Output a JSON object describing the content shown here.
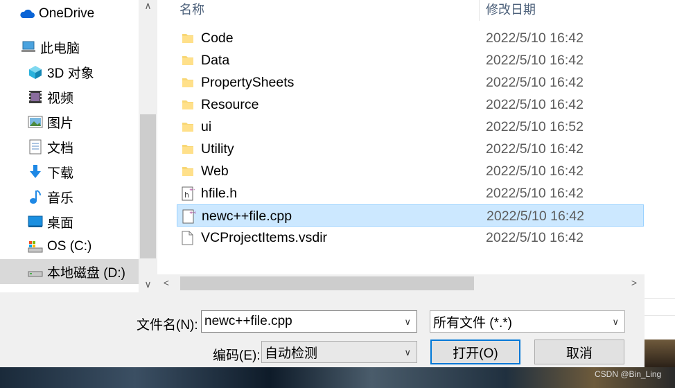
{
  "nav": {
    "items": [
      {
        "label": "OneDrive",
        "icon": "onedrive-cloud-icon"
      },
      {
        "label": "此电脑",
        "icon": "this-pc-icon"
      },
      {
        "label": "3D 对象",
        "icon": "3d-objects-icon"
      },
      {
        "label": "视频",
        "icon": "video-icon"
      },
      {
        "label": "图片",
        "icon": "pictures-icon"
      },
      {
        "label": "文档",
        "icon": "documents-icon"
      },
      {
        "label": "下载",
        "icon": "download-arrow-icon"
      },
      {
        "label": "音乐",
        "icon": "music-note-icon"
      },
      {
        "label": "桌面",
        "icon": "desktop-icon"
      },
      {
        "label": "OS (C:)",
        "icon": "drive-c-icon"
      },
      {
        "label": "本地磁盘 (D:)",
        "icon": "drive-d-icon"
      }
    ],
    "selected_index": 10
  },
  "columns": {
    "name": "名称",
    "date": "修改日期"
  },
  "files": [
    {
      "name": "Code",
      "date": "2022/5/10 16:42",
      "type": "folder"
    },
    {
      "name": "Data",
      "date": "2022/5/10 16:42",
      "type": "folder"
    },
    {
      "name": "PropertySheets",
      "date": "2022/5/10 16:42",
      "type": "folder"
    },
    {
      "name": "Resource",
      "date": "2022/5/10 16:42",
      "type": "folder"
    },
    {
      "name": "ui",
      "date": "2022/5/10 16:52",
      "type": "folder"
    },
    {
      "name": "Utility",
      "date": "2022/5/10 16:42",
      "type": "folder"
    },
    {
      "name": "Web",
      "date": "2022/5/10 16:42",
      "type": "folder"
    },
    {
      "name": "hfile.h",
      "date": "2022/5/10 16:42",
      "type": "header"
    },
    {
      "name": "newc++file.cpp",
      "date": "2022/5/10 16:42",
      "type": "cpp"
    },
    {
      "name": "VCProjectItems.vsdir",
      "date": "2022/5/10 16:42",
      "type": "file"
    }
  ],
  "selected_file_index": 8,
  "bottom": {
    "filename_label": "文件名(N):",
    "filename_value": "newc++file.cpp",
    "filter_value": "所有文件 (*.*)",
    "encoding_label": "编码(E):",
    "encoding_value": "自动检测",
    "open_button": "打开(O)",
    "cancel_button": "取消"
  },
  "watermark": "CSDN @Bin_Ling",
  "colors": {
    "selection": "#cce8ff",
    "selection_border": "#99d1ff",
    "accent": "#0078d7"
  }
}
